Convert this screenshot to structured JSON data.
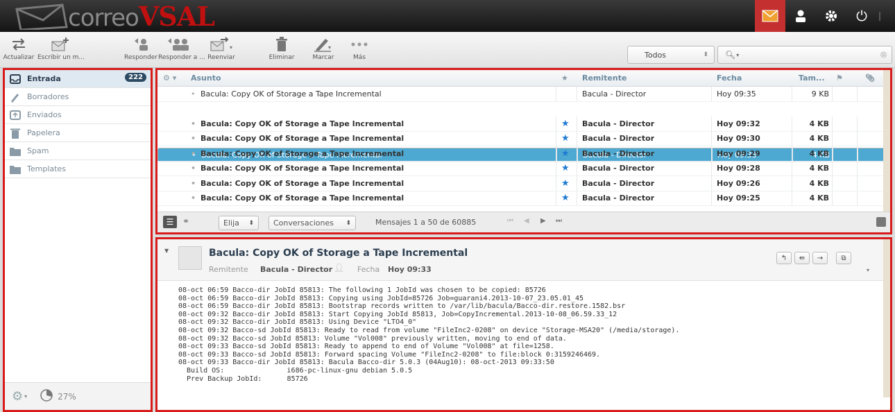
{
  "app": {
    "brand_part1": "correo",
    "brand_part2": "VSAL"
  },
  "toolbar": {
    "refresh": "Actualizar",
    "compose": "Escribir un m...",
    "reply": "Responder",
    "reply_all": "Responder a ...",
    "forward": "Reenviar",
    "delete": "Eliminar",
    "mark": "Marcar",
    "more": "Más",
    "filter_value": "Todos",
    "search_placeholder": ""
  },
  "folders": [
    {
      "name": "Entrada",
      "count": "222",
      "icon": "inbox-icon"
    },
    {
      "name": "Borradores",
      "icon": "pencil-icon"
    },
    {
      "name": "Enviados",
      "icon": "sent-icon"
    },
    {
      "name": "Papelera",
      "icon": "trash-icon"
    },
    {
      "name": "Spam",
      "icon": "folder-icon"
    },
    {
      "name": "Templates",
      "icon": "folder-icon"
    }
  ],
  "quota": "27%",
  "columns": {
    "subject": "Asunto",
    "sender": "Remitente",
    "date": "Fecha",
    "size": "Tam..."
  },
  "messages": [
    {
      "subject": "Bacula: Copy OK of Storage a Tape Incremental",
      "sender": "Bacula - Director",
      "date": "Hoy 09:35",
      "size": "9 KB"
    },
    {
      "subject": "Bacula: Copy OK of Storage a Tape Incremental",
      "sender": "Bacula - Director",
      "date": "Hoy 09:33",
      "size": "4 KB"
    },
    {
      "subject": "Bacula: Copy OK of Storage a Tape Incremental",
      "sender": "Bacula - Director",
      "date": "Hoy 09:32",
      "size": "4 KB"
    },
    {
      "subject": "Bacula: Copy OK of Storage a Tape Incremental",
      "sender": "Bacula - Director",
      "date": "Hoy 09:30",
      "size": "4 KB"
    },
    {
      "subject": "Bacula: Copy OK of Storage a Tape Incremental",
      "sender": "Bacula - Director",
      "date": "Hoy 09:29",
      "size": "4 KB"
    },
    {
      "subject": "Bacula: Copy OK of Storage a Tape Incremental",
      "sender": "Bacula - Director",
      "date": "Hoy 09:28",
      "size": "4 KB"
    },
    {
      "subject": "Bacula: Copy OK of Storage a Tape Incremental",
      "sender": "Bacula - Director",
      "date": "Hoy 09:26",
      "size": "4 KB"
    },
    {
      "subject": "Bacula: Copy OK of Storage a Tape Incremental",
      "sender": "Bacula - Director",
      "date": "Hoy 09:25",
      "size": "4 KB"
    }
  ],
  "list_footer": {
    "select": "Elija",
    "threads": "Conversaciones",
    "count_text": "Mensajes 1 a 50 de 60885"
  },
  "preview": {
    "subject": "Bacula: Copy OK of Storage a Tape Incremental",
    "sender_label": "Remitente",
    "sender": "Bacula - Director",
    "date_label": "Fecha",
    "date": "Hoy 09:33",
    "body_lines": [
      "08-oct 06:59 Bacco-dir JobId 85813: The following 1 JobId was chosen to be copied: 85726",
      "08-oct 06:59 Bacco-dir JobId 85813: Copying using JobId=85726 Job=guarani4.2013-10-07_23.05.01_45",
      "08-oct 06:59 Bacco-dir JobId 85813: Bootstrap records written to /var/lib/bacula/Bacco-dir.restore.1582.bsr",
      "08-oct 09:32 Bacco-dir JobId 85813: Start Copying JobId 85813, Job=CopyIncremental.2013-10-08_06.59.33_12",
      "08-oct 09:32 Bacco-dir JobId 85813: Using Device \"LTO4_0\"",
      "08-oct 09:32 Bacco-sd JobId 85813: Ready to read from volume \"FileInc2-0208\" on device \"Storage-MSA20\" (/media/storage).",
      "08-oct 09:32 Bacco-sd JobId 85813: Volume \"Vol008\" previously written, moving to end of data.",
      "08-oct 09:33 Bacco-sd JobId 85813: Ready to append to end of Volume \"Vol008\" at file=1258.",
      "08-oct 09:33 Bacco-sd JobId 85813: Forward spacing Volume \"FileInc2-0208\" to file:block 0:3159246469.",
      "08-oct 09:33 Bacco-dir JobId 85813: Bacula Bacco-dir 5.0.3 (04Aug10): 08-oct-2013 09:33:50",
      "  Build OS:               i686-pc-linux-gnu debian 5.0.5",
      "  Prev Backup JobId:      85726"
    ]
  }
}
